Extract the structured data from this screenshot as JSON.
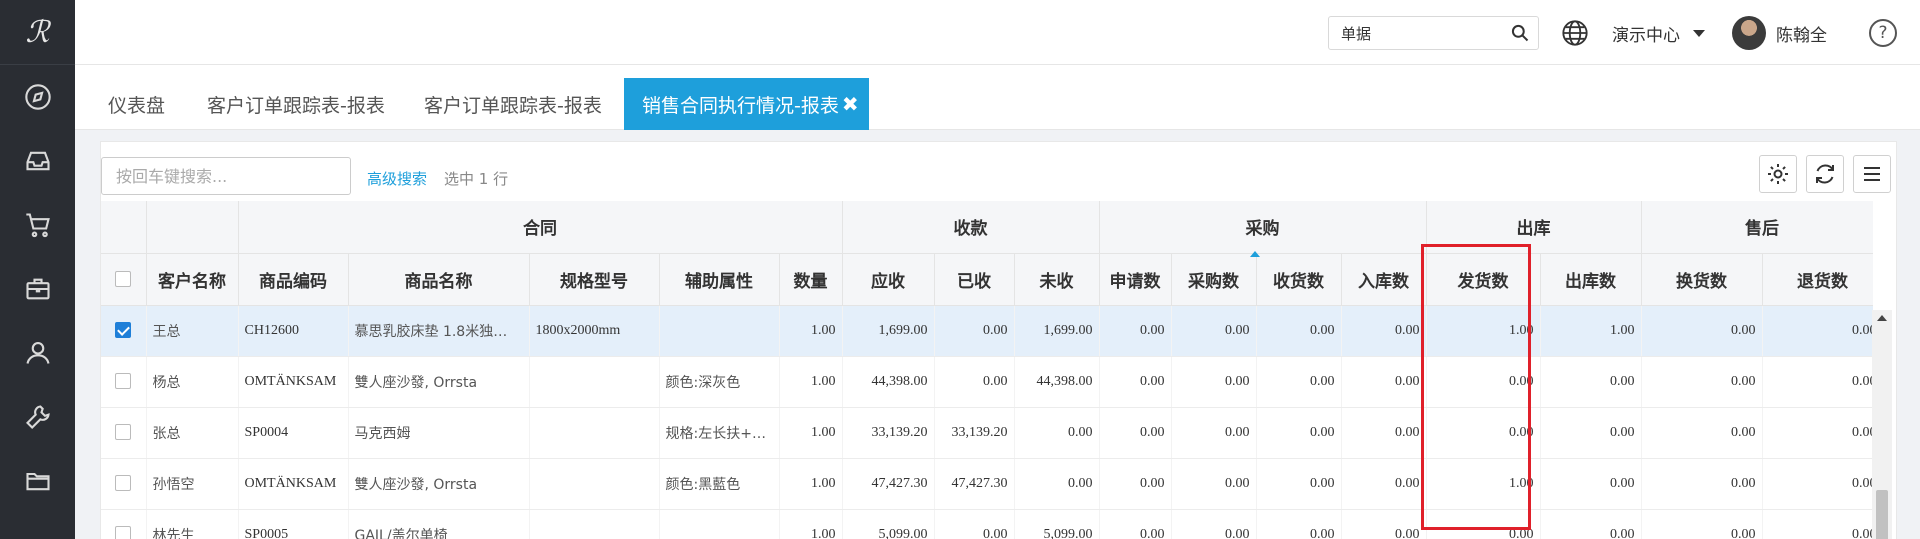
{
  "logo": "ℛ",
  "sidebar": {
    "items": [
      {
        "icon": "compass-icon"
      },
      {
        "icon": "inbox-icon"
      },
      {
        "icon": "cart-icon"
      },
      {
        "icon": "briefcase-icon"
      },
      {
        "icon": "user-icon"
      },
      {
        "icon": "wrench-icon"
      },
      {
        "icon": "folder-icon"
      }
    ]
  },
  "header": {
    "search_value": "单据",
    "center_label": "演示中心",
    "user_name": "陈翰全",
    "help": "?"
  },
  "tabs": [
    {
      "label": "仪表盘"
    },
    {
      "label": "客户订单跟踪表-报表"
    },
    {
      "label": "客户订单跟踪表-报表"
    },
    {
      "label": "销售合同执行情况-报表",
      "active": true,
      "close": "✖"
    }
  ],
  "toolbar": {
    "search_placeholder": "按回车键搜索...",
    "advanced_search": "高级搜索",
    "selection_text": "选中 1 行"
  },
  "grid": {
    "groups": [
      "合同",
      "收款",
      "采购",
      "出库",
      "售后"
    ],
    "columns": [
      "客户名称",
      "商品编码",
      "商品名称",
      "规格型号",
      "辅助属性",
      "数量",
      "应收",
      "已收",
      "未收",
      "申请数",
      "采购数",
      "收货数",
      "入库数",
      "发货数",
      "出库数",
      "换货数",
      "退货数"
    ],
    "rows": [
      {
        "checked": true,
        "cells": [
          "王总",
          "CH12600",
          "慕思乳胶床垫 1.8米独…",
          "1800x2000mm",
          "",
          "1.00",
          "1,699.00",
          "0.00",
          "1,699.00",
          "0.00",
          "0.00",
          "0.00",
          "0.00",
          "1.00",
          "1.00",
          "0.00",
          "0.00"
        ]
      },
      {
        "checked": false,
        "cells": [
          "杨总",
          "OMTÄNKSAM",
          "雙人座沙發, Orrsta",
          "",
          "颜色:深灰色",
          "1.00",
          "44,398.00",
          "0.00",
          "44,398.00",
          "0.00",
          "0.00",
          "0.00",
          "0.00",
          "0.00",
          "0.00",
          "0.00",
          "0.00"
        ]
      },
      {
        "checked": false,
        "cells": [
          "张总",
          "SP0004",
          "马克西姆",
          "",
          "规格:左长扶+…",
          "1.00",
          "33,139.20",
          "33,139.20",
          "0.00",
          "0.00",
          "0.00",
          "0.00",
          "0.00",
          "0.00",
          "0.00",
          "0.00",
          "0.00"
        ]
      },
      {
        "checked": false,
        "cells": [
          "孙悟空",
          "OMTÄNKSAM",
          "雙人座沙發, Orrsta",
          "",
          "颜色:黑藍色",
          "1.00",
          "47,427.30",
          "47,427.30",
          "0.00",
          "0.00",
          "0.00",
          "0.00",
          "0.00",
          "1.00",
          "0.00",
          "0.00",
          "0.00"
        ]
      },
      {
        "checked": false,
        "cells": [
          "林先生",
          "SP0005",
          "GAIL/盖尔单椅",
          "",
          "",
          "1.00",
          "5,099.00",
          "0.00",
          "5,099.00",
          "0.00",
          "0.00",
          "0.00",
          "0.00",
          "0.00",
          "0.00",
          "0.00",
          "0.00"
        ]
      }
    ]
  },
  "colors": {
    "accent": "#1e9fdb",
    "sidebar": "#2a2d33",
    "highlight": "#e0202a",
    "selected_row": "#e4effa"
  }
}
